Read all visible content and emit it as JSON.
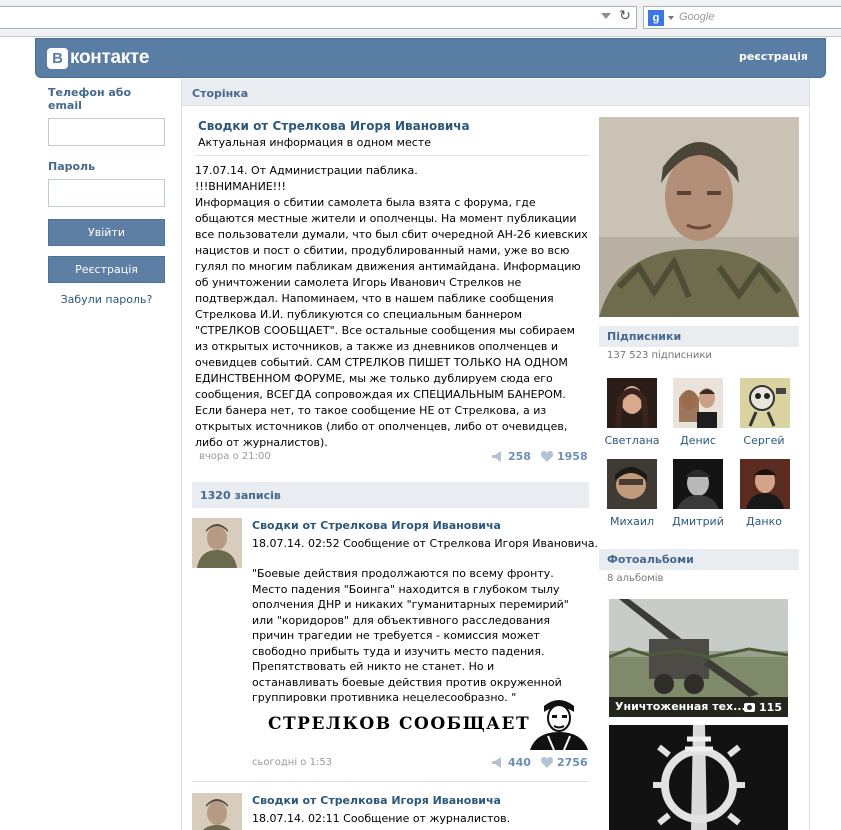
{
  "browser": {
    "search_placeholder": "Google",
    "search_engine_icon": "g"
  },
  "header": {
    "logo_letter": "B",
    "logo_text": "контакте",
    "register_link": "реєстрація"
  },
  "login": {
    "email_label": "Телефон або email",
    "password_label": "Пароль",
    "login_button": "Увійти",
    "register_button": "Реєстрація",
    "forgot_link": "Забули пароль?"
  },
  "page": {
    "strip_title": "Сторінка",
    "group_name": "Сводки от Стрелкова Игоря Ивановича",
    "group_status": "Актуальная информация в одном месте"
  },
  "pinned_post": {
    "line1": "17.07.14. От Администрации паблика.",
    "line2": "!!!ВНИМАНИЕ!!!",
    "body": "Информация о сбитии самолета была взята с форума, где общаются местные жители и ополченцы. На момент публикации все пользователи думали, что был сбит очередной АН-26 киевских нацистов и пост о сбитии, продублированный нами, уже во всю гулял по многим пабликам движения антимайдана. Информацию об уничтожении самолета Игорь Иванович Стрелков не подтверждал. Напоминаем, что в нашем паблике сообщения Стрелкова И.И. публикуются со специальным баннером \"СТРЕЛКОВ СООБЩАЕТ\". Все остальные сообщения мы собираем из открытых источников, а также из дневников ополченцев и очевидцев событий. САМ СТРЕЛКОВ ПИШЕТ ТОЛЬКО НА ОДНОМ ЕДИНСТВЕННОМ ФОРУМЕ, мы же только дублируем сюда его сообщения, ВСЕГДА сопровождая их СПЕЦИАЛЬНЫМ БАНЕРОМ. Если банера нет, то такое сообщение НЕ от Стрелкова, а из открытых источников (либо от ополченцев, либо от очевидцев, либо от журналистов).",
    "date": "вчора о 21:00",
    "shares": "258",
    "likes": "1958"
  },
  "wall": {
    "records_count": "1320 записів",
    "posts": [
      {
        "author": "Сводки от Стрелкова Игоря Ивановича",
        "headline": "18.07.14. 02:52 Сообщение от Стрелкова Игоря Ивановича.",
        "quote": "\"Боевые действия продолжаются по всему фронту. Место падения \"Боинга\" находится в глубоком тылу ополчения ДНР и никаких \"гуманитарных перемирий\" или \"коридоров\" для объективного расследования причин трагедии не требуется - комиссия может свободно прибыть туда и изучить место падения. Препятствовать ей никто не станет. Но и останавливать боевые действия против окруженной группировки противника нецелесообразно. \"",
        "banner_text": "СТРЕЛКОВ СООБЩАЕТ:",
        "date": "сьогодні о 1:53",
        "shares": "440",
        "likes": "2756"
      },
      {
        "author": "Сводки от Стрелкова Игоря Ивановича",
        "headline": "18.07.14. 02:11 Сообщение от журналистов."
      }
    ]
  },
  "sidebar": {
    "subscribers_title": "Підписники",
    "subscribers_count": "137 523 підписники",
    "subscribers": [
      {
        "name": "Светлана"
      },
      {
        "name": "Денис"
      },
      {
        "name": "Сергей"
      },
      {
        "name": "Михаил"
      },
      {
        "name": "Дмитрий"
      },
      {
        "name": "Данко"
      }
    ],
    "albums_title": "Фотоальбоми",
    "albums_count": "8 альбомів",
    "albums": [
      {
        "caption": "Уничтоженная тех...",
        "count": "115"
      }
    ]
  },
  "colors": {
    "brand": "#597da3",
    "link": "#2b587a",
    "header_text": "#45688e",
    "strip_bg": "#e9edf1"
  }
}
